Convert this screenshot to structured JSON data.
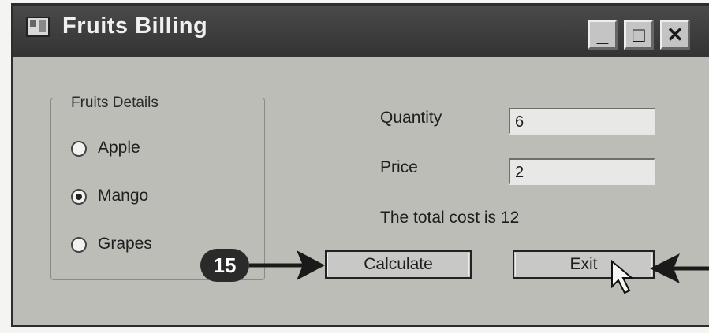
{
  "window": {
    "title": "Fruits Billing",
    "icon": "app-window-icon",
    "controls": {
      "minimize": "_",
      "maximize": "□",
      "close": "✕"
    }
  },
  "group": {
    "legend": "Fruits Details",
    "options": [
      {
        "label": "Apple",
        "checked": false
      },
      {
        "label": "Mango",
        "checked": true
      },
      {
        "label": "Grapes",
        "checked": false
      }
    ]
  },
  "form": {
    "quantity_label": "Quantity",
    "quantity_value": "6",
    "price_label": "Price",
    "price_value": "2",
    "result": "The total cost is 12"
  },
  "buttons": {
    "calculate": "Calculate",
    "exit": "Exit"
  },
  "annotation": {
    "step": "15"
  }
}
